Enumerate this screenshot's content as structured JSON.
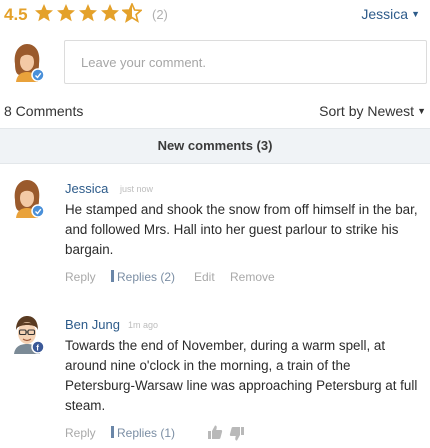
{
  "rating": {
    "score": "4.5",
    "stars_filled": 4.5,
    "stars_total": 5,
    "count": "(2)"
  },
  "user_menu": {
    "name": "Jessica"
  },
  "composer": {
    "placeholder": "Leave your comment."
  },
  "comments_bar": {
    "count_label": "8 Comments",
    "sort_label": "Sort by Newest"
  },
  "new_comments": {
    "label": "New comments (3)"
  },
  "comments": [
    {
      "author": "Jessica",
      "time": "just now",
      "badge": "logo",
      "text": "He stamped and shook the snow from off himself in the bar, and followed Mrs. Hall into her guest parlour to strike his bargain.",
      "actions": {
        "reply": "Reply",
        "replies": "Replies (2)",
        "edit": "Edit",
        "remove": "Remove"
      }
    },
    {
      "author": "Ben Jung",
      "time": "1m ago",
      "badge": "facebook",
      "text": "Towards the end of November, during a warm spell, at around nine o'clock in the morning, a train of the Petersburg-Warsaw line was approaching Petersburg at full steam.",
      "actions": {
        "reply": "Reply",
        "replies": "Replies (1)"
      }
    }
  ],
  "colors": {
    "star": "#e4a12a",
    "link": "#2d5b8a",
    "badge": "#4a90d9",
    "facebook": "#3b5998"
  },
  "icons": {
    "star": "star-icon",
    "caret": "caret-down-icon",
    "upvote": "thumbs-up-icon",
    "downvote": "thumbs-down-icon"
  }
}
